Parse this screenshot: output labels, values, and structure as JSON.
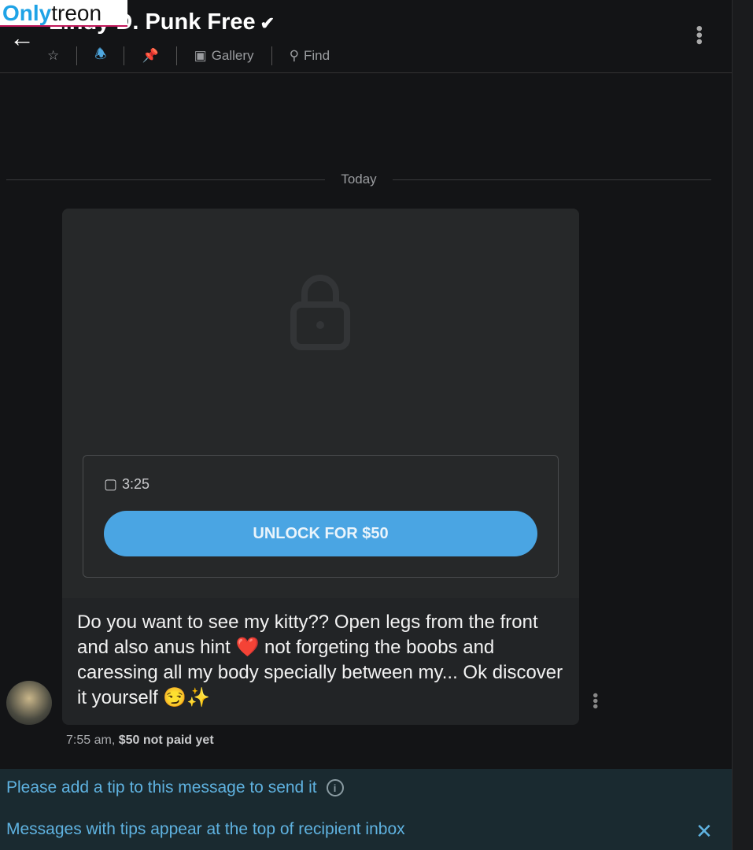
{
  "header": {
    "back_icon": "arrow-left-icon",
    "title": "Lindy D. Punk Free",
    "verified_icon": "verified-badge-icon",
    "tools": {
      "star_icon": "star-icon",
      "bell_icon": "bell-icon",
      "pin_icon": "pin-icon",
      "gallery": "Gallery",
      "find": "Find"
    },
    "more_icon": "vertical-dots-icon"
  },
  "watermark": {
    "part1": "Only",
    "part2": "treon"
  },
  "date_divider": "Today",
  "message": {
    "media_icon": "lock-icon",
    "duration": "3:25",
    "unlock_label": "UNLOCK FOR $50",
    "text": "Do you want to see my kitty?? Open legs from the front and also anus hint ❤️ not forgeting the boobs and caressing all my body specially between my... Ok discover it yourself 😏✨",
    "time": "7:55 am,",
    "price_status": "$50 not paid yet"
  },
  "tip_notice": {
    "line1": "Please add a tip to this message to send it",
    "line2": "Messages with tips appear at the top of recipient inbox",
    "info_icon": "info-icon",
    "close_icon": "close-icon"
  },
  "colors": {
    "accent": "#4aa5e3",
    "background": "#131416",
    "bubble": "#222426",
    "tip_bar": "#1a2a30"
  }
}
